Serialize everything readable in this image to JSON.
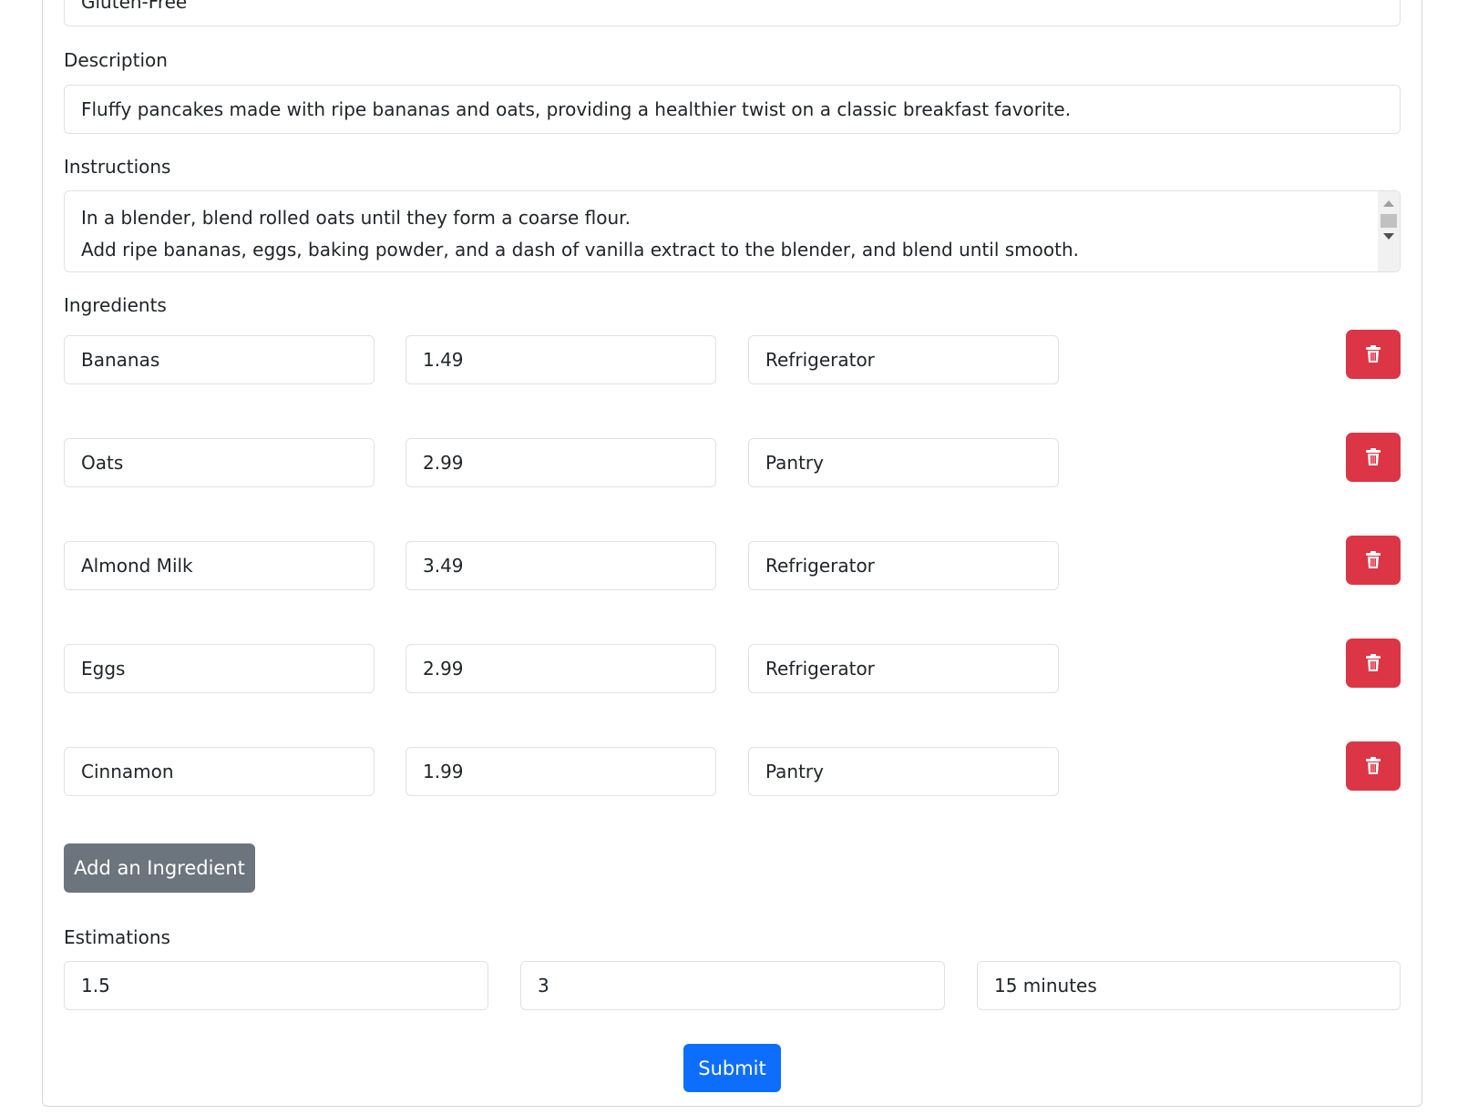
{
  "top_field": {
    "value": "Gluten-Free"
  },
  "description": {
    "label": "Description",
    "value": "Fluffy pancakes made with ripe bananas and oats, providing a healthier twist on a classic breakfast favorite."
  },
  "instructions": {
    "label": "Instructions",
    "lines": [
      "In a blender, blend rolled oats until they form a coarse flour.",
      "Add ripe bananas, eggs, baking powder, and a dash of vanilla extract to the blender, and blend until smooth."
    ]
  },
  "ingredients": {
    "label": "Ingredients",
    "items": [
      {
        "name": "Bananas",
        "price": "1.49",
        "location": "Refrigerator"
      },
      {
        "name": "Oats",
        "price": "2.99",
        "location": "Pantry"
      },
      {
        "name": "Almond Milk",
        "price": "3.49",
        "location": "Refrigerator"
      },
      {
        "name": "Eggs",
        "price": "2.99",
        "location": "Refrigerator"
      },
      {
        "name": "Cinnamon",
        "price": "1.99",
        "location": "Pantry"
      }
    ],
    "delete_icon": "trash-icon",
    "add_label": "Add an Ingredient"
  },
  "estimations": {
    "label": "Estimations",
    "values": [
      "1.5",
      "3",
      "15 minutes"
    ]
  },
  "submit_label": "Submit",
  "colors": {
    "danger": "#dc3545",
    "primary": "#0d6efd",
    "secondary": "#6c757d"
  }
}
